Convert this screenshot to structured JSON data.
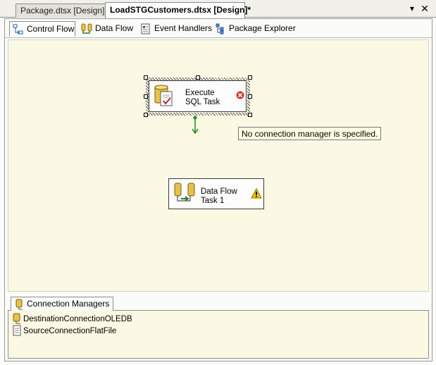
{
  "document_tabs": [
    {
      "label": "Package.dtsx [Design]",
      "active": false
    },
    {
      "label": "LoadSTGCustomers.dtsx [Design]*",
      "active": true
    }
  ],
  "window_controls": {
    "menu_glyph": "▾",
    "close_glyph": "✕"
  },
  "designer_tabs": [
    {
      "label": "Control Flow",
      "icon": "control-flow-icon",
      "selected": true
    },
    {
      "label": "Data Flow",
      "icon": "data-flow-icon",
      "selected": false
    },
    {
      "label": "Event Handlers",
      "icon": "event-handlers-icon",
      "selected": false
    },
    {
      "label": "Package Explorer",
      "icon": "package-explorer-icon",
      "selected": false
    }
  ],
  "canvas": {
    "tasks": [
      {
        "line1": "Execute",
        "line2": "SQL Task",
        "status": "error",
        "icon": "execute-sql-task-icon"
      },
      {
        "line1": "Data Flow",
        "line2": "Task 1",
        "status": "warning",
        "icon": "data-flow-task-icon"
      }
    ],
    "tooltip": "No connection manager is specified."
  },
  "connection_managers": {
    "tab_label": "Connection Managers",
    "items": [
      {
        "label": "DestinationConnectionOLEDB",
        "icon": "oledb-connection-icon"
      },
      {
        "label": "SourceConnectionFlatFile",
        "icon": "flatfile-connection-icon"
      }
    ]
  },
  "colors": {
    "canvas_background": "#fbf8e4",
    "error": "#d9302c",
    "warning": "#f5c400",
    "precedence_arrow": "#1e8a1e"
  }
}
